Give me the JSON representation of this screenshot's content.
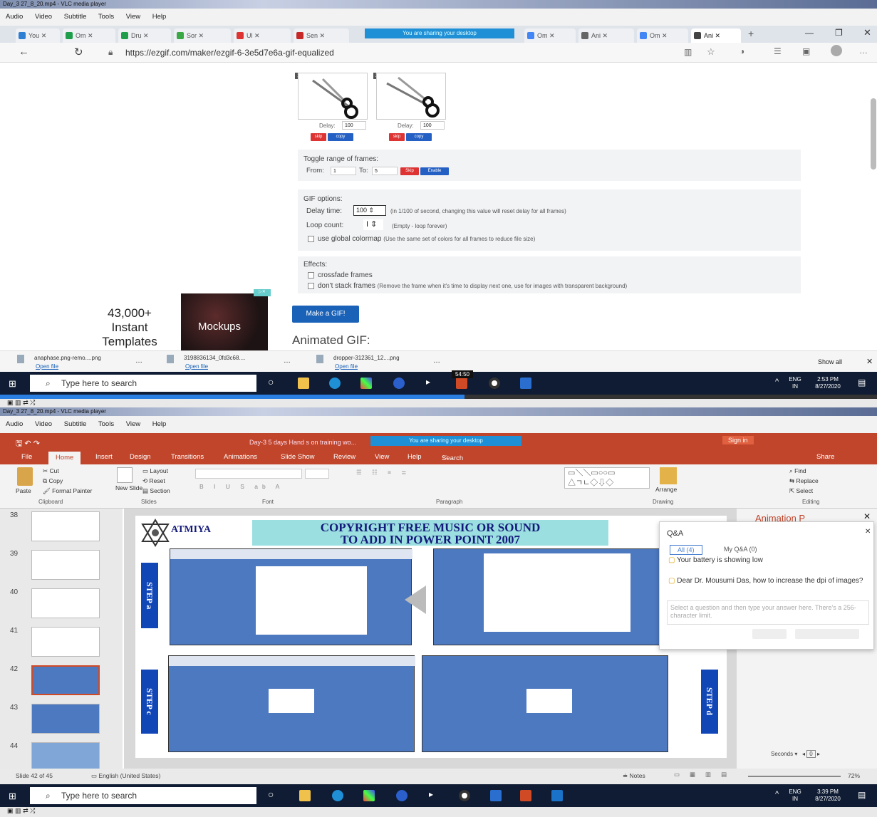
{
  "top": {
    "vlc_title": "Day_3 27_8_20.mp4 - VLC media player",
    "menu": [
      "Audio",
      "Video",
      "Subtitle",
      "Tools",
      "View",
      "Help"
    ],
    "sharing_banner": "You are sharing your desktop",
    "url": "https://ezgif.com/maker/ezgif-6-3e5d7e6a-gif-equalized",
    "frames": [
      {
        "num": "1",
        "delay_label": "Delay:",
        "delay": "100",
        "skip": "skip",
        "copy": "copy"
      },
      {
        "num": "2",
        "delay_label": "Delay:",
        "delay": "100",
        "skip": "skip",
        "copy": "copy"
      }
    ],
    "toggle": {
      "title": "Toggle range of frames:",
      "from_label": "From:",
      "from": "1",
      "to_label": "To:",
      "to": "5",
      "skip": "Skip",
      "enable": "Enable"
    },
    "gif_options": {
      "title": "GIF options:",
      "delay_label": "Delay time:",
      "delay_value": "100",
      "delay_note": "(in 1/100 of second, changing this value will reset delay for all frames)",
      "loop_label": "Loop count:",
      "loop_note": "(Empty - loop forever)",
      "colormap": "use global colormap",
      "colormap_note": "(Use the same set of colors for all frames to reduce file size)"
    },
    "effects": {
      "title": "Effects:",
      "crossfade": "crossfade frames",
      "nostack": "don't stack frames",
      "nostack_note": "(Remove the frame when it's time to display next one, use for images with transparent background)"
    },
    "make_button": "Make a GIF!",
    "animated_heading": "Animated GIF:",
    "ad": {
      "line1": "43,000+",
      "line2": "Instant",
      "line3": "Templates",
      "img_label": "Mockups"
    },
    "downloads": [
      {
        "name": "anaphase.png-remo....png",
        "open": "Open file"
      },
      {
        "name": "3198836134_0fd3c68....",
        "open": "Open file"
      },
      {
        "name": "dropper-312361_12....png",
        "open": "Open file"
      }
    ],
    "show_all": "Show all",
    "taskbar": {
      "search": "Type here to search",
      "lang": "ENG",
      "region": "IN",
      "time": "2:53 PM",
      "date": "8/27/2020"
    },
    "timecode": "54:50",
    "progress": 0.53
  },
  "bottom": {
    "vlc_title": "Day_3 27_8_20.mp4 - VLC media player",
    "menu": [
      "Audio",
      "Video",
      "Subtitle",
      "Tools",
      "View",
      "Help"
    ],
    "ppt_title": "Day-3 5 days Hand s on training wo...",
    "sharing_banner": "You are sharing your desktop",
    "sign_in": "Sign in",
    "tabs": [
      "File",
      "Home",
      "Insert",
      "Design",
      "Transitions",
      "Animations",
      "Slide Show",
      "Review",
      "View",
      "Help",
      "Search"
    ],
    "share": "Share",
    "ribbon": {
      "paste": "Paste",
      "cut": "Cut",
      "copy": "Copy",
      "format_painter": "Format Painter",
      "new_slide": "New Slide",
      "layout": "Layout",
      "reset": "Reset",
      "section": "Section",
      "arrange": "Arrange",
      "find": "Find",
      "replace": "Replace",
      "select": "Select",
      "groups": [
        "Clipboard",
        "Slides",
        "Font",
        "Paragraph",
        "Drawing",
        "Editing"
      ]
    },
    "slide_numbers": [
      "38",
      "39",
      "40",
      "41",
      "42",
      "43",
      "44"
    ],
    "slide_title_1": "COPYRIGHT FREE MUSIC OR SOUND",
    "slide_title_2": "TO ADD IN POWER POINT   2007",
    "logo": "ATMIYA",
    "steps": [
      "STEP a",
      "STEP c",
      "STEP d"
    ],
    "animation_pane": "Animation P",
    "qa": {
      "title": "Q&A",
      "tab_all": "All (4)",
      "tab_my": "My Q&A (0)",
      "msg1": "Your battery is showing low",
      "msg2": "Dear Dr. Mousumi Das, how to increase the dpi of images?",
      "hint": "Select a question and then type your answer here. There's a 256-character limit."
    },
    "status": {
      "slide": "Slide 42 of 45",
      "lang": "English (United States)",
      "notes": "Notes",
      "zoom": "72%",
      "seconds": "Seconds",
      "secval": "0"
    },
    "taskbar": {
      "search": "Type here to search",
      "lang": "ENG",
      "region": "IN",
      "time": "3:39 PM",
      "date": "8/27/2020"
    }
  }
}
